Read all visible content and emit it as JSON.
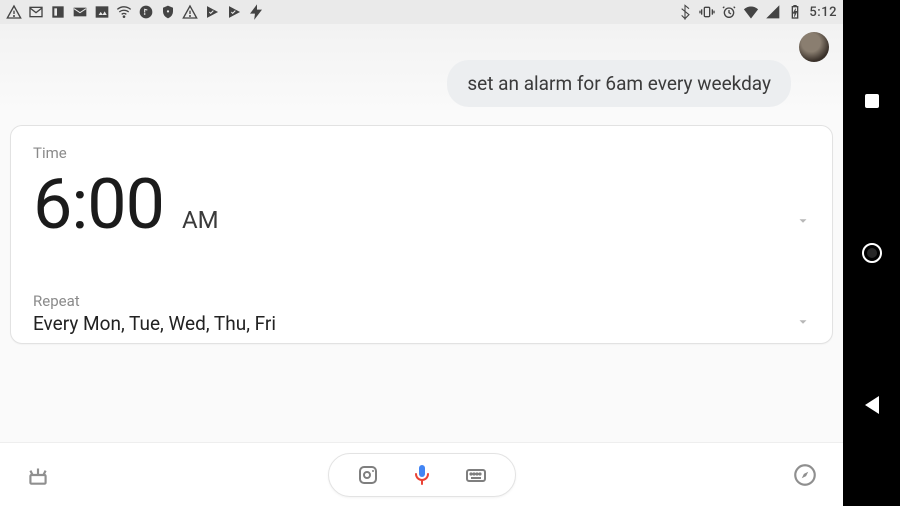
{
  "statusbar": {
    "time": "5:12"
  },
  "chat": {
    "user_message": "set an alarm for 6am every weekday"
  },
  "alarm_card": {
    "time_label": "Time",
    "time_value": "6:00",
    "ampm": "AM",
    "repeat_label": "Repeat",
    "repeat_value": "Every Mon, Tue, Wed, Thu, Fri"
  }
}
